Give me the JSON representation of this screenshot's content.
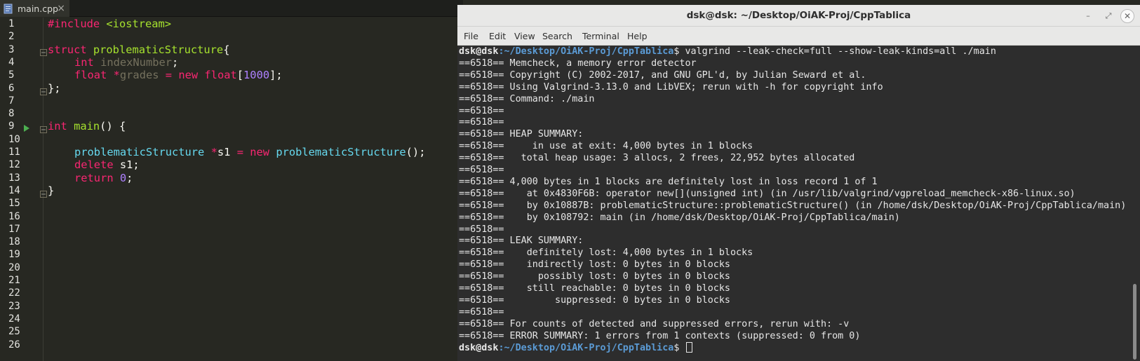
{
  "editor": {
    "tab": {
      "filename": "main.cpp",
      "close": "×"
    },
    "line_numbers": [
      "1",
      "2",
      "3",
      "4",
      "5",
      "6",
      "7",
      "8",
      "9",
      "10",
      "11",
      "12",
      "13",
      "14",
      "15",
      "16",
      "17",
      "18",
      "19",
      "20",
      "21",
      "22",
      "23",
      "24",
      "25",
      "26"
    ],
    "code": {
      "l1": {
        "a": "#include ",
        "b": "<iostream>"
      },
      "l3": {
        "kw": "struct",
        "name": " problematicStructure",
        "brace": "{"
      },
      "l4": {
        "type": "int",
        "field": " indexNumber",
        "semi": ";"
      },
      "l5": {
        "type": "float",
        "ptr": " *",
        "field": "grades",
        "eq": " = ",
        "new": "new",
        "sp": " ",
        "type2": "float",
        "lb": "[",
        "num": "1000",
        "rb": "];"
      },
      "l6": {
        "text": "};"
      },
      "l9": {
        "kw": "int",
        "sp": " ",
        "fn": "main",
        "rest": "() {"
      },
      "l11": {
        "cls": "problematicStructure",
        "ptr": " *",
        "var": "s1",
        "eq": " = ",
        "new": "new",
        "sp": " ",
        "ctor": "problematicStructure",
        "end": "();"
      },
      "l12": {
        "kw": "delete",
        "rest": " s1;"
      },
      "l13": {
        "kw": "return",
        "sp": " ",
        "num": "0",
        "semi": ";"
      },
      "l14": {
        "text": "}"
      }
    }
  },
  "terminal": {
    "title": "dsk@dsk: ~/Desktop/OiAK-Proj/CppTablica",
    "window_buttons": {
      "minimize": "–",
      "maximize": "⤢",
      "close": "✕"
    },
    "menu": [
      "File",
      "Edit",
      "View",
      "Search",
      "Terminal",
      "Help"
    ],
    "prompt_user": "dsk@dsk",
    "prompt_path": ":~/Desktop/OiAK-Proj/CppTablica",
    "prompt_sign": "$",
    "command": " valgrind --leak-check=full --show-leak-kinds=all ./main",
    "output": [
      "==6518== Memcheck, a memory error detector",
      "==6518== Copyright (C) 2002-2017, and GNU GPL'd, by Julian Seward et al.",
      "==6518== Using Valgrind-3.13.0 and LibVEX; rerun with -h for copyright info",
      "==6518== Command: ./main",
      "==6518==",
      "==6518==",
      "==6518== HEAP SUMMARY:",
      "==6518==     in use at exit: 4,000 bytes in 1 blocks",
      "==6518==   total heap usage: 3 allocs, 2 frees, 22,952 bytes allocated",
      "==6518==",
      "==6518== 4,000 bytes in 1 blocks are definitely lost in loss record 1 of 1",
      "==6518==    at 0x4830F6B: operator new[](unsigned int) (in /usr/lib/valgrind/vgpreload_memcheck-x86-linux.so)",
      "==6518==    by 0x10887B: problematicStructure::problematicStructure() (in /home/dsk/Desktop/OiAK-Proj/CppTablica/main)",
      "==6518==    by 0x108792: main (in /home/dsk/Desktop/OiAK-Proj/CppTablica/main)",
      "==6518==",
      "==6518== LEAK SUMMARY:",
      "==6518==    definitely lost: 4,000 bytes in 1 blocks",
      "==6518==    indirectly lost: 0 bytes in 0 blocks",
      "==6518==      possibly lost: 0 bytes in 0 blocks",
      "==6518==    still reachable: 0 bytes in 0 blocks",
      "==6518==         suppressed: 0 bytes in 0 blocks",
      "==6518==",
      "==6518== For counts of detected and suppressed errors, rerun with: -v",
      "==6518== ERROR SUMMARY: 1 errors from 1 contexts (suppressed: 0 from 0)"
    ],
    "final_prompt": {
      "user": "dsk@dsk",
      "path": ":~/Desktop/OiAK-Proj/CppTablica",
      "sign": "$ "
    }
  }
}
